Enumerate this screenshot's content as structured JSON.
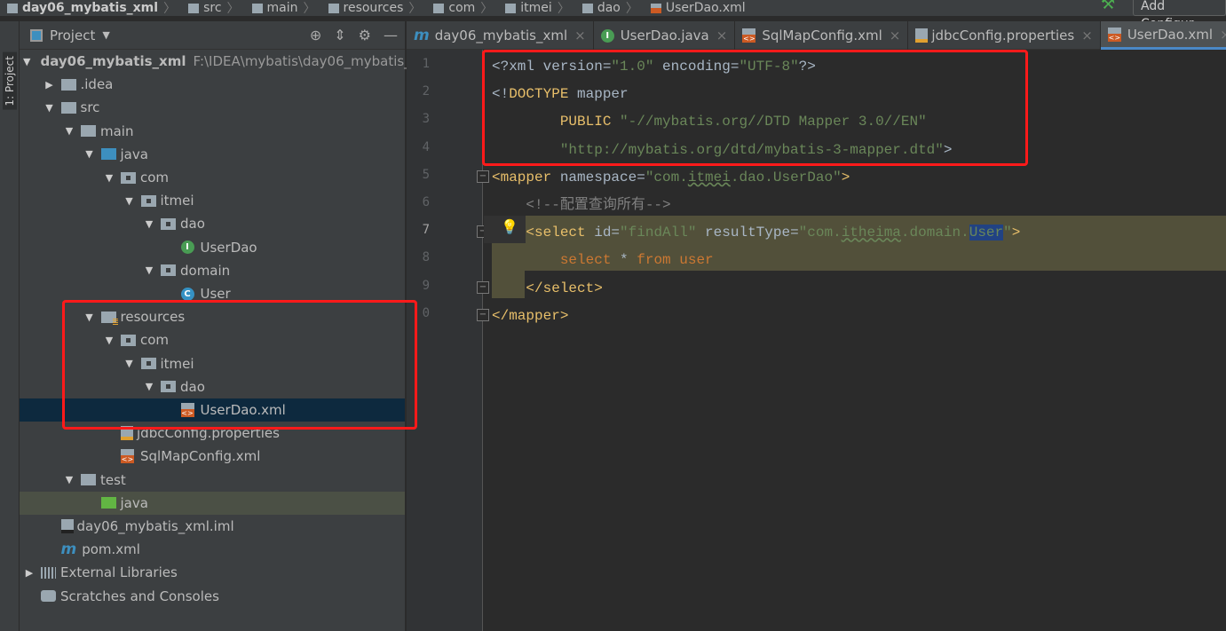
{
  "breadcrumbs": [
    "day06_mybatis_xml",
    "src",
    "main",
    "resources",
    "com",
    "itmei",
    "dao",
    "UserDao.xml"
  ],
  "toolbar": {
    "add_config": "Add Configur"
  },
  "stripe": {
    "project_label": "1: Project"
  },
  "project_panel": {
    "title": "Project",
    "tree": [
      {
        "label": "day06_mybatis_xml",
        "path": "F:\\IDEA\\mybatis\\day06_mybatis_",
        "depth": 0,
        "icon": "folder",
        "open": true,
        "bold": true
      },
      {
        "label": ".idea",
        "depth": 1,
        "icon": "folder",
        "open": false
      },
      {
        "label": "src",
        "depth": 1,
        "icon": "folder",
        "open": true
      },
      {
        "label": "main",
        "depth": 2,
        "icon": "folder",
        "open": true
      },
      {
        "label": "java",
        "depth": 3,
        "icon": "folder-blue",
        "open": true
      },
      {
        "label": "com",
        "depth": 4,
        "icon": "package",
        "open": true
      },
      {
        "label": "itmei",
        "depth": 5,
        "icon": "package",
        "open": true
      },
      {
        "label": "dao",
        "depth": 6,
        "icon": "package",
        "open": true
      },
      {
        "label": "UserDao",
        "depth": 7,
        "icon": "interface"
      },
      {
        "label": "domain",
        "depth": 6,
        "icon": "package",
        "open": true
      },
      {
        "label": "User",
        "depth": 7,
        "icon": "class"
      },
      {
        "label": "resources",
        "depth": 3,
        "icon": "resources",
        "open": true
      },
      {
        "label": "com",
        "depth": 4,
        "icon": "package",
        "open": true
      },
      {
        "label": "itmei",
        "depth": 5,
        "icon": "package",
        "open": true
      },
      {
        "label": "dao",
        "depth": 6,
        "icon": "package",
        "open": true
      },
      {
        "label": "UserDao.xml",
        "depth": 7,
        "icon": "xml",
        "selected": true
      },
      {
        "label": "jdbcConfig.properties",
        "depth": 4,
        "icon": "properties"
      },
      {
        "label": "SqlMapConfig.xml",
        "depth": 4,
        "icon": "xml"
      },
      {
        "label": "test",
        "depth": 2,
        "icon": "folder",
        "open": true
      },
      {
        "label": "java",
        "depth": 3,
        "icon": "folder-green",
        "highlighted": true
      },
      {
        "label": "day06_mybatis_xml.iml",
        "depth": 1,
        "icon": "iml"
      },
      {
        "label": "pom.xml",
        "depth": 1,
        "icon": "maven"
      },
      {
        "label": "External Libraries",
        "depth": 0,
        "icon": "libraries",
        "open": false
      },
      {
        "label": "Scratches and Consoles",
        "depth": 0,
        "icon": "scratches"
      }
    ]
  },
  "tabs": [
    {
      "label": "day06_mybatis_xml",
      "icon": "maven"
    },
    {
      "label": "UserDao.java",
      "icon": "interface"
    },
    {
      "label": "SqlMapConfig.xml",
      "icon": "xml"
    },
    {
      "label": "jdbcConfig.properties",
      "icon": "properties"
    },
    {
      "label": "UserDao.xml",
      "icon": "xml",
      "active": true
    }
  ],
  "editor": {
    "line_numbers": [
      "1",
      "2",
      "3",
      "4",
      "5",
      "6",
      "7",
      "8",
      "9",
      "0"
    ],
    "lines": [
      [
        [
          "t-plain",
          "<?xml version="
        ],
        [
          "t-str",
          "\"1.0\""
        ],
        [
          "t-plain",
          " encoding="
        ],
        [
          "t-str",
          "\"UTF-8\""
        ],
        [
          "t-plain",
          "?>"
        ]
      ],
      [
        [
          "t-plain",
          "<!"
        ],
        [
          "t-tag",
          "DOCTYPE"
        ],
        [
          "t-plain",
          " mapper"
        ]
      ],
      [
        [
          "t-plain",
          "        "
        ],
        [
          "t-tag",
          "PUBLIC"
        ],
        [
          "t-plain",
          " "
        ],
        [
          "t-str",
          "\"-//mybatis.org//DTD Mapper 3.0//EN\""
        ]
      ],
      [
        [
          "t-plain",
          "        "
        ],
        [
          "t-str",
          "\"http://mybatis.org/dtd/mybatis-3-mapper.dtd\""
        ],
        [
          "t-plain",
          ">"
        ]
      ],
      [
        [
          "t-tag",
          "<mapper "
        ],
        [
          "t-plain",
          "namespace="
        ],
        [
          "t-str",
          "\"com."
        ],
        [
          "t-str u",
          "itmei"
        ],
        [
          "t-str",
          ".dao.UserDao\""
        ],
        [
          "t-tag",
          ">"
        ]
      ],
      [
        [
          "t-com",
          "    <!--配置查询所有-->"
        ]
      ],
      [
        [
          "t-tag",
          "    <select "
        ],
        [
          "t-plain",
          "id="
        ],
        [
          "t-str",
          "\"findAll\""
        ],
        [
          "t-plain",
          " resultType="
        ],
        [
          "t-str",
          "\"com."
        ],
        [
          "t-str u",
          "itheima"
        ],
        [
          "t-str",
          ".domain."
        ],
        [
          "t-sel",
          "User"
        ],
        [
          "t-str",
          "\""
        ],
        [
          "t-tag",
          ">"
        ]
      ],
      [
        [
          "t-sql",
          "        select "
        ],
        [
          "t-plain",
          "* "
        ],
        [
          "t-sql",
          "from user"
        ]
      ],
      [
        [
          "t-tag",
          "    </select>"
        ]
      ],
      [
        [
          "t-tag",
          "</mapper>"
        ]
      ]
    ]
  },
  "colors": {
    "highlight_box": "#ff1a1a",
    "selection": "#0d293e",
    "editor_bg": "#2b2b2b",
    "panel_bg": "#3c3f41"
  }
}
